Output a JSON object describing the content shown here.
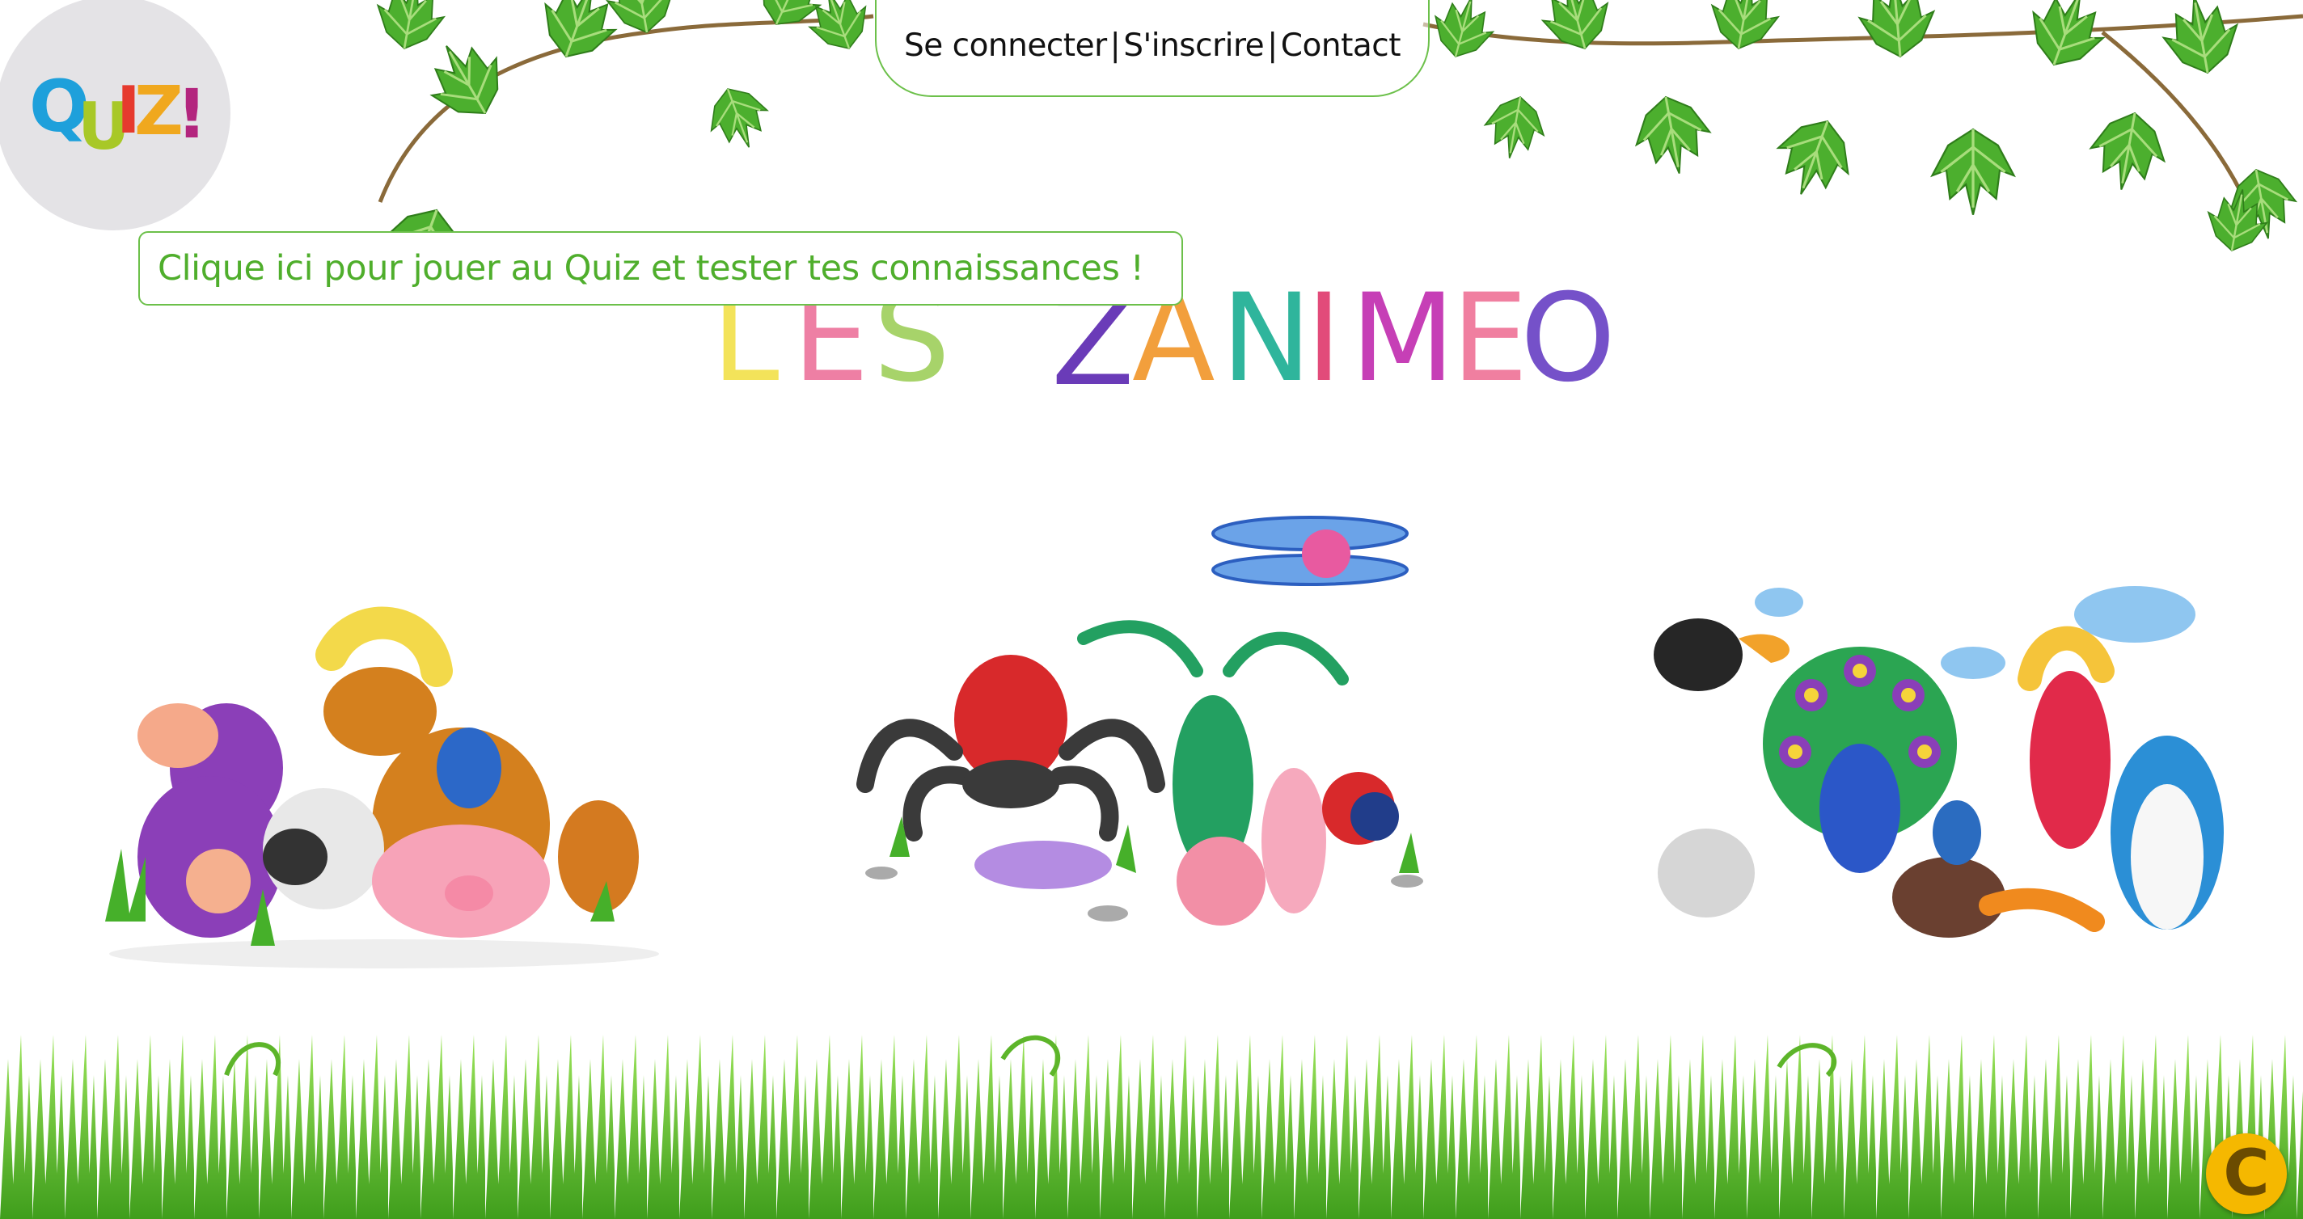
{
  "nav": {
    "login": "Se connecter",
    "separator": "|",
    "signup": "S'inscrire",
    "contact": "Contact"
  },
  "quiz": {
    "logo_text": "QUIZ!",
    "callout": "Clique ici pour jouer au Quiz et tester tes connaissances !"
  },
  "title": {
    "word1": "LES",
    "word2": "ZANIMEO"
  },
  "scenes": [
    {
      "icon": "farm-animals-illustration"
    },
    {
      "icon": "bugs-illustration"
    },
    {
      "icon": "birds-illustration"
    }
  ],
  "copyright_badge": "C",
  "colors": {
    "accent_green": "#6cc04a",
    "callout_text": "#4fae2c",
    "logo_circle": "#e4e3e6",
    "badge": "#f5b800"
  }
}
